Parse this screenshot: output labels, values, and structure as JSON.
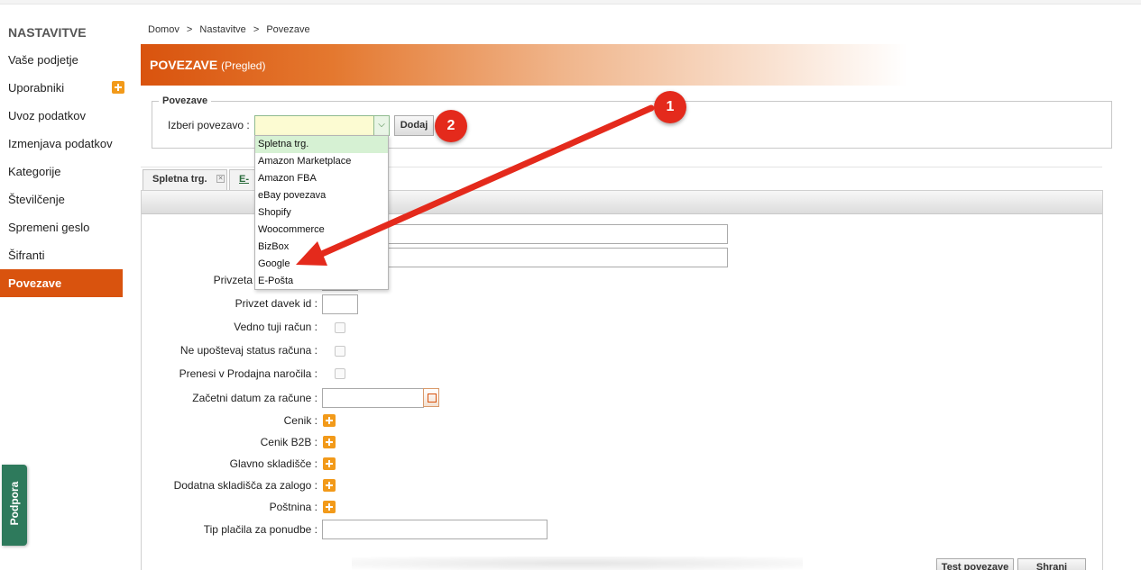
{
  "sidebar": {
    "title": "NASTAVITVE",
    "items": [
      {
        "label": "Vaše podjetje"
      },
      {
        "label": "Uporabniki"
      },
      {
        "label": "Uvoz podatkov"
      },
      {
        "label": "Izmenjava podatkov"
      },
      {
        "label": "Kategorije"
      },
      {
        "label": "Številčenje"
      },
      {
        "label": "Spremeni geslo"
      },
      {
        "label": "Šifranti"
      },
      {
        "label": "Povezave"
      }
    ],
    "active": "Povezave",
    "plus_icon": "plus-icon"
  },
  "breadcrumb": [
    "Domov",
    ">",
    "Nastavitve",
    ">",
    "Povezave"
  ],
  "header": {
    "title": "POVEZAVE",
    "subtitle": "(Pregled)",
    "accent": "#d9530e"
  },
  "povezave_box": {
    "legend": "Povezave",
    "label": "Izberi povezavo :",
    "select_value": "",
    "button": "Dodaj",
    "options": [
      "Spletna trg.",
      "Amazon Marketplace",
      "Amazon FBA",
      "eBay povezava",
      "Shopify",
      "Woocommerce",
      "BizBox",
      "Google",
      "E-Pošta"
    ],
    "highlighted_option": "Spletna trg."
  },
  "badges": {
    "one": "1",
    "two": "2",
    "color": "#e42a1c"
  },
  "tabs": [
    {
      "label": "Spletna trg."
    },
    {
      "label": "E-P"
    }
  ],
  "form": {
    "privzeta_label": "Privzeta",
    "privzet_davek_label": "Privzet davek id :",
    "vedno_tuji_label": "Vedno tuji račun :",
    "ne_upostevaj_label": "Ne upoštevaj status računa :",
    "prenesi_label": "Prenesi v Prodajna naročila :",
    "zacetni_datum_label": "Začetni datum za račune :",
    "cenik_label": "Cenik :",
    "cenik_b2b_label": "Cenik B2B :",
    "glavno_label": "Glavno skladišče :",
    "dodatna_label": "Dodatna skladišča za zalogo :",
    "postnina_label": "Poštnina :",
    "tip_placila_label": "Tip plačila za ponudbe :"
  },
  "buttons": {
    "test": "Test povezave",
    "save": "Shrani"
  },
  "support": {
    "label": "Podpora",
    "color": "#2e7a5c"
  }
}
